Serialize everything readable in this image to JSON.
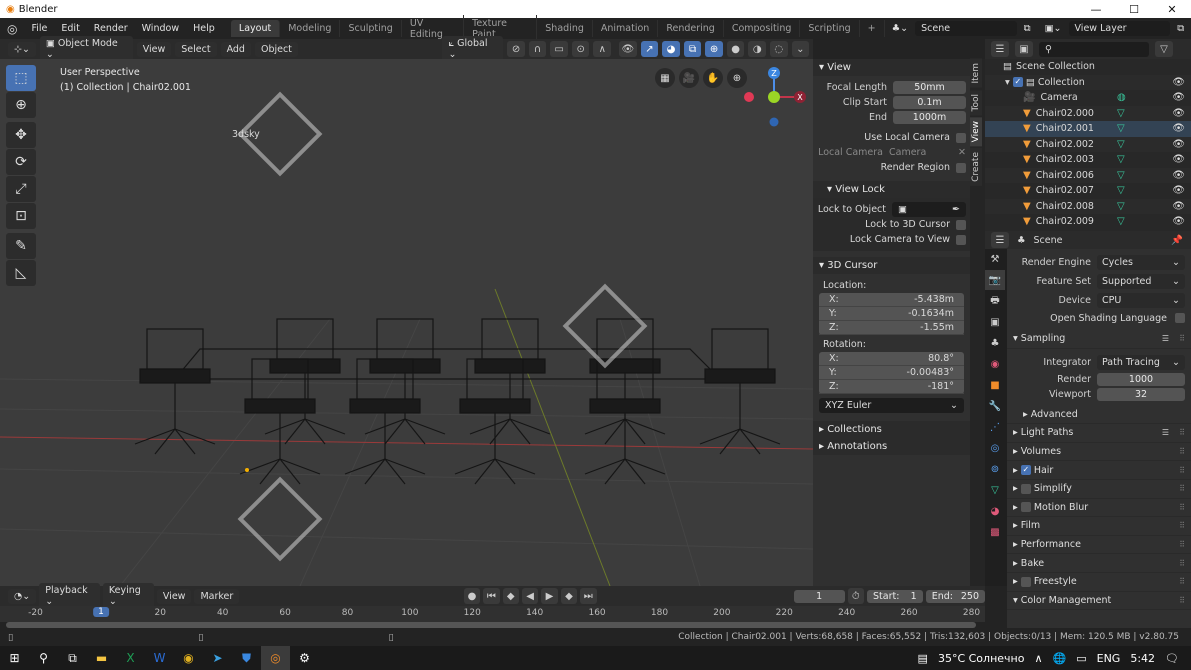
{
  "window": {
    "title": "Blender",
    "controls": [
      "minimize",
      "maximize",
      "close"
    ]
  },
  "menu": [
    "File",
    "Edit",
    "Render",
    "Window",
    "Help"
  ],
  "workspaces": [
    {
      "label": "Layout",
      "active": true
    },
    {
      "label": "Modeling"
    },
    {
      "label": "Sculpting"
    },
    {
      "label": "UV Editing"
    },
    {
      "label": "Texture Paint"
    },
    {
      "label": "Shading"
    },
    {
      "label": "Animation"
    },
    {
      "label": "Rendering"
    },
    {
      "label": "Compositing"
    },
    {
      "label": "Scripting"
    }
  ],
  "add_workspace": "+",
  "scene_selector": "Scene",
  "view_layer_selector": "View Layer",
  "viewport_header": {
    "mode": "Object Mode",
    "menus": [
      "View",
      "Select",
      "Add",
      "Object"
    ],
    "orientation": "Global"
  },
  "viewport": {
    "perspective": "User Perspective",
    "context": "(1) Collection | Chair02.001",
    "watermark": "3dsky",
    "gizmo_axes": {
      "x": "X",
      "y": "Y",
      "z": "Z"
    }
  },
  "npanel": {
    "tabs": [
      "Item",
      "Tool",
      "View",
      "Create"
    ],
    "active_tab": "View",
    "view": {
      "title": "View",
      "focal_length_label": "Focal Length",
      "focal_length": "50mm",
      "clip_start_label": "Clip Start",
      "clip_start": "0.1m",
      "end_label": "End",
      "end": "1000m",
      "use_local_camera": "Use Local Camera",
      "local_camera_label": "Local Camera",
      "local_camera": "Camera",
      "render_region": "Render Region"
    },
    "view_lock": {
      "title": "View Lock",
      "lock_to_object": "Lock to Object",
      "lock_to_3d_cursor": "Lock to 3D Cursor",
      "lock_camera_to_view": "Lock Camera to View"
    },
    "cursor": {
      "title": "3D Cursor",
      "location_label": "Location:",
      "location": [
        {
          "axis": "X:",
          "value": "-5.438m"
        },
        {
          "axis": "Y:",
          "value": "-0.1634m"
        },
        {
          "axis": "Z:",
          "value": "-1.55m"
        }
      ],
      "rotation_label": "Rotation:",
      "rotation": [
        {
          "axis": "X:",
          "value": "80.8°"
        },
        {
          "axis": "Y:",
          "value": "-0.00483°"
        },
        {
          "axis": "Z:",
          "value": "-181°"
        }
      ],
      "rotation_mode": "XYZ Euler"
    },
    "collections": "Collections",
    "annotations": "Annotations"
  },
  "outliner": {
    "root": "Scene Collection",
    "collection": "Collection",
    "items": [
      "Camera",
      "Chair02.000",
      "Chair02.001",
      "Chair02.002",
      "Chair02.003",
      "Chair02.006",
      "Chair02.007",
      "Chair02.008",
      "Chair02.009"
    ]
  },
  "properties": {
    "header": "Scene",
    "render_engine_label": "Render Engine",
    "render_engine": "Cycles",
    "feature_set_label": "Feature Set",
    "feature_set": "Supported",
    "device_label": "Device",
    "device": "CPU",
    "osl": "Open Shading Language",
    "sampling": {
      "title": "Sampling",
      "integrator_label": "Integrator",
      "integrator": "Path Tracing",
      "render_label": "Render",
      "render": "1000",
      "viewport_label": "Viewport",
      "viewport": "32",
      "advanced": "Advanced"
    },
    "sections": [
      {
        "label": "Light Paths"
      },
      {
        "label": "Volumes"
      },
      {
        "label": "Hair",
        "checkbox": true,
        "checked": true
      },
      {
        "label": "Simplify",
        "checkbox": true,
        "checked": false
      },
      {
        "label": "Motion Blur",
        "checkbox": true,
        "checked": false
      },
      {
        "label": "Film"
      },
      {
        "label": "Performance"
      },
      {
        "label": "Bake"
      },
      {
        "label": "Freestyle",
        "checkbox": true,
        "checked": false
      },
      {
        "label": "Color Management",
        "open": true
      }
    ]
  },
  "timeline": {
    "menus": [
      "Playback",
      "Keying",
      "View",
      "Marker"
    ],
    "current_frame": "1",
    "start_label": "Start:",
    "start": "1",
    "end_label": "End:",
    "end": "250",
    "ticks": [
      "-20",
      "20",
      "40",
      "60",
      "80",
      "100",
      "120",
      "140",
      "160",
      "180",
      "200",
      "220",
      "240",
      "260",
      "280"
    ]
  },
  "status_bar": "Collection | Chair02.001 | Verts:68,658 | Faces:65,552 | Tris:132,603 | Objects:0/13 | Mem: 120.5 MB | v2.80.75",
  "taskbar": {
    "weather": "35°C Солнечно",
    "lang": "ENG",
    "time": "5:42"
  }
}
